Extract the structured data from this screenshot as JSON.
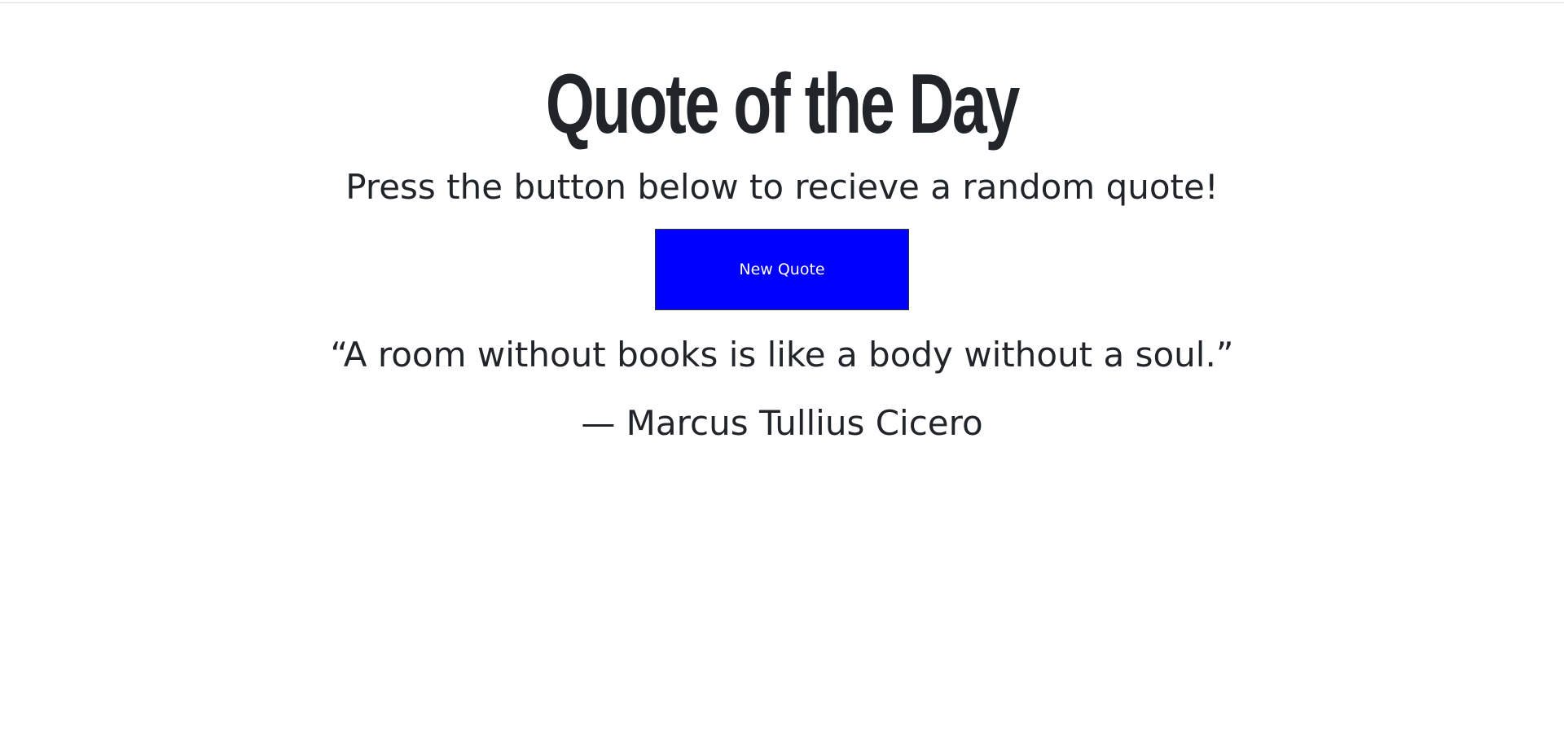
{
  "page": {
    "title": "Quote of the Day",
    "subtitle": "Press the button below to recieve a random quote!"
  },
  "button": {
    "label": "New Quote",
    "color": "#0000ff"
  },
  "quote": {
    "text": "“A room without books is like a body without a soul.”",
    "author": "— Marcus Tullius Cicero"
  }
}
